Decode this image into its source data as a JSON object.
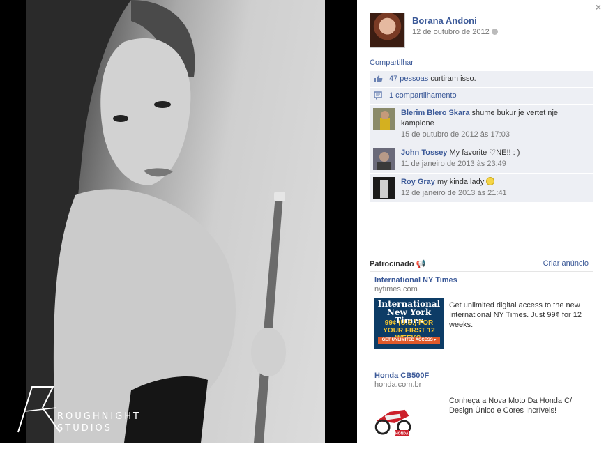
{
  "photo": {
    "watermark_line1": "Roughnight",
    "watermark_line2": "Studios"
  },
  "close_label": "×",
  "post": {
    "author": "Borana Andoni",
    "date": "12 de outubro de 2012",
    "share": "Compartilhar"
  },
  "ufi": {
    "likes_link": "47 pessoas",
    "likes_text": " curtiram isso.",
    "shares": "1 compartilhamento"
  },
  "comments": [
    {
      "name": "Blerim Blero Skara",
      "text": " shume bukur je vertet nje kampione",
      "time": "15 de outubro de 2012 às 17:03"
    },
    {
      "name": "John Tossey",
      "text": " My favorite ♡NE!! : )",
      "time": "11 de janeiro de 2013 às 23:49"
    },
    {
      "name": "Roy Gray",
      "text": " my kinda lady ",
      "time": "12 de janeiro de 2013 às 21:41"
    }
  ],
  "sponsored": {
    "title": "Patrocinado",
    "create_ad": "Criar anúncio",
    "ads": [
      {
        "title": "International NY Times",
        "domain": "nytimes.com",
        "text": "Get unlimited digital access to the new International NY Times. Just 99¢ for 12 weeks.",
        "img_logo": "International New York Times",
        "img_offer": "99¢ (U.S.) FOR YOUR FIRST 12 WEEKS.",
        "img_button": "GET UNLIMITED ACCESS ▸"
      },
      {
        "title": "Honda CB500F",
        "domain": "honda.com.br",
        "text": "Conheça a Nova Moto Da Honda C/ Design Único e Cores Incríveis!",
        "img_brand": "HONDA"
      }
    ]
  },
  "colors": {
    "link": "#3b5998",
    "ufi_bg": "#edeff4",
    "photo_bg": "#000000"
  }
}
